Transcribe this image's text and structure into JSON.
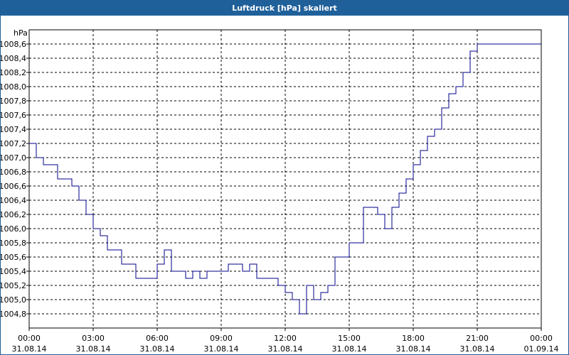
{
  "window": {
    "title": "Luftdruck [hPa] skaliert"
  },
  "chart_data": {
    "type": "line",
    "title": "Luftdruck [hPa] skaliert",
    "ylabel": "hPa",
    "xlabel": "",
    "ylim": [
      1004.6,
      1008.8
    ],
    "y_ticks": [
      "1004,8",
      "1005,0",
      "1005,2",
      "1005,4",
      "1005,6",
      "1005,8",
      "1006,0",
      "1006,2",
      "1006,4",
      "1006,6",
      "1006,8",
      "1007,0",
      "1007,2",
      "1007,4",
      "1007,6",
      "1007,8",
      "1008,0",
      "1008,2",
      "1008,4",
      "1008,6"
    ],
    "x_ticks": [
      {
        "time": "00:00",
        "date": "31.08.14"
      },
      {
        "time": "03:00",
        "date": "31.08.14"
      },
      {
        "time": "06:00",
        "date": "31.08.14"
      },
      {
        "time": "09:00",
        "date": "31.08.14"
      },
      {
        "time": "12:00",
        "date": "31.08.14"
      },
      {
        "time": "15:00",
        "date": "31.08.14"
      },
      {
        "time": "18:00",
        "date": "31.08.14"
      },
      {
        "time": "21:00",
        "date": "31.08.14"
      },
      {
        "time": "00:00",
        "date": "01.09.14"
      }
    ],
    "grid": true,
    "line_color": "#00008b",
    "series": [
      {
        "x": [
          "00:00",
          "00:20",
          "00:40",
          "01:00",
          "01:20",
          "01:40",
          "02:00",
          "02:20",
          "02:40",
          "03:00",
          "03:20",
          "03:40",
          "04:00",
          "04:20",
          "04:40",
          "05:00",
          "05:20",
          "05:40",
          "06:00",
          "06:20",
          "06:40",
          "07:00",
          "07:20",
          "07:40",
          "08:00",
          "08:20",
          "08:40",
          "09:00",
          "09:20",
          "09:40",
          "10:00",
          "10:20",
          "10:40",
          "11:00",
          "11:20",
          "11:40",
          "12:00",
          "12:20",
          "12:40",
          "13:00",
          "13:20",
          "13:40",
          "14:00",
          "14:20",
          "14:40",
          "15:00",
          "15:20",
          "15:40",
          "16:00",
          "16:20",
          "16:40",
          "17:00",
          "17:20",
          "17:40",
          "18:00",
          "18:20",
          "18:40",
          "19:00",
          "19:20",
          "19:40",
          "20:00",
          "20:20",
          "20:40",
          "21:00",
          "21:20",
          "21:40",
          "22:00",
          "22:20",
          "22:40",
          "23:00",
          "23:20",
          "23:40",
          "24:00"
        ],
        "y": [
          1007.2,
          1007.0,
          1006.9,
          1006.9,
          1006.7,
          1006.7,
          1006.6,
          1006.4,
          1006.2,
          1006.0,
          1005.9,
          1005.7,
          1005.7,
          1005.5,
          1005.5,
          1005.3,
          1005.3,
          1005.3,
          1005.5,
          1005.7,
          1005.4,
          1005.4,
          1005.3,
          1005.4,
          1005.3,
          1005.4,
          1005.4,
          1005.4,
          1005.5,
          1005.5,
          1005.4,
          1005.5,
          1005.3,
          1005.3,
          1005.3,
          1005.2,
          1005.1,
          1005.0,
          1004.8,
          1005.2,
          1005.0,
          1005.1,
          1005.2,
          1005.6,
          1005.6,
          1005.8,
          1005.8,
          1006.3,
          1006.3,
          1006.2,
          1006.0,
          1006.3,
          1006.5,
          1006.7,
          1006.9,
          1007.1,
          1007.3,
          1007.4,
          1007.7,
          1007.9,
          1008.0,
          1008.2,
          1008.5,
          1008.6,
          1008.6,
          1008.6,
          1008.6,
          1008.6,
          1008.6,
          1008.6,
          1008.6,
          1008.6,
          1008.6
        ]
      }
    ]
  }
}
